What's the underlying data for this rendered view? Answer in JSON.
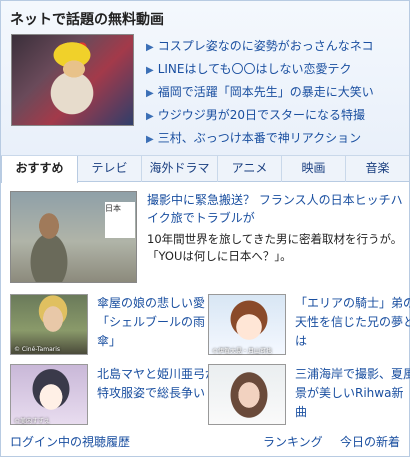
{
  "top": {
    "title": "ネットで話題の無料動画",
    "links": [
      "コスプレ姿なのに姿勢がおっさんなネコ",
      "LINEはしても〇〇はしない恋愛テク",
      "福岡で活躍「岡本先生」の暴走に大笑い",
      "ウジウジ男が20日でスターになる特撮",
      "三村、ぶっつけ本番で神リアクション"
    ]
  },
  "tabs": [
    "おすすめ",
    "テレビ",
    "海外ドラマ",
    "アニメ",
    "映画",
    "音楽"
  ],
  "featured": {
    "sign_text": "日本",
    "title": "撮影中に緊急搬送？ フランス人の日本ヒッチハイク旅でトラブルが",
    "desc": "10年間世界を旅してきた男に密着取材を行うが。「YOUは何しに日本へ？」。"
  },
  "grid": [
    {
      "text": "傘屋の娘の悲しい愛「シェルブールの雨傘」",
      "caption": "© Ciné-Tamaris"
    },
    {
      "text": "「エリアの騎士」弟の天性を信じた兄の夢とは",
      "caption": "©伊賀大晃・月山可也"
    },
    {
      "text": "北島マヤと姫川亜弓が特攻服姿で総長争い",
      "caption": "©美内すずえ"
    },
    {
      "text": "三浦海岸で撮影、夏風景が美しいRihwa新曲",
      "caption": ""
    }
  ],
  "footer": {
    "history": "ログイン中の視聴履歴",
    "ranking": "ランキング",
    "new": "今日の新着"
  },
  "colors": {
    "link": "#1a4fa0",
    "border": "#b8cbe2",
    "header_bg": "#eef3fa"
  }
}
